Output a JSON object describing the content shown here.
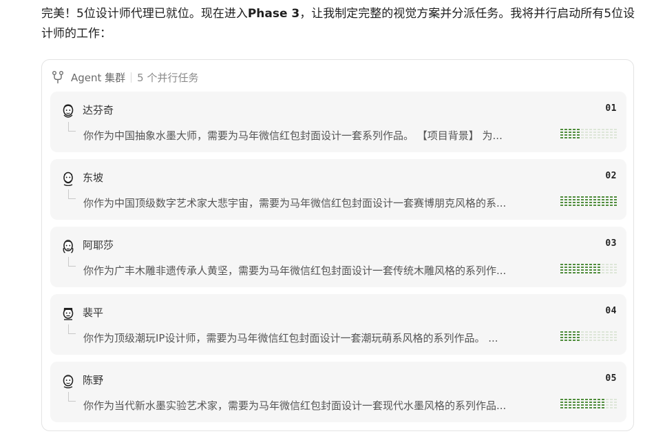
{
  "intro": {
    "part1": "完美！5位设计师代理已就位。现在进入",
    "phase": "Phase 3",
    "part2": "，让我制定完整的视觉方案并分派任务。我将并行启动所有5位设计师的工作："
  },
  "panel": {
    "title": "Agent 集群",
    "count": "5 个并行任务",
    "icon": "agent-cluster-icon"
  },
  "tasks": [
    {
      "name": "达芬奇",
      "num": "01",
      "desc": "你作为中国抽象水墨大师，需要为马年微信红包封面设计一套系列作品。 【项目背景】 为...",
      "progress": 0.35,
      "avatar": "portrait-icon"
    },
    {
      "name": "东坡",
      "num": "02",
      "desc": "你作为中国顶级数字艺术家大悲宇宙，需要为马年微信红包封面设计一套赛博朋克风格的系...",
      "progress": 1.0,
      "avatar": "portrait-icon"
    },
    {
      "name": "阿耶莎",
      "num": "03",
      "desc": "你作为广丰木雕非遗传承人黄坚，需要为马年微信红包封面设计一套传统木雕风格的系列作...",
      "progress": 0.7,
      "avatar": "portrait-icon"
    },
    {
      "name": "裴平",
      "num": "04",
      "desc": "你作为顶级潮玩IP设计师，需要为马年微信红包封面设计一套潮玩萌系风格的系列作品。 ...",
      "progress": 0.35,
      "avatar": "portrait-icon"
    },
    {
      "name": "陈野",
      "num": "05",
      "desc": "你作为当代新水墨实验艺术家，需要为马年微信红包封面设计一套现代水墨风格的系列作品...",
      "progress": 0.75,
      "avatar": "portrait-icon"
    }
  ],
  "colors": {
    "progress_on": "#4e8c3a",
    "progress_off": "#dde6d8",
    "card_bg": "#f6f6f6"
  }
}
